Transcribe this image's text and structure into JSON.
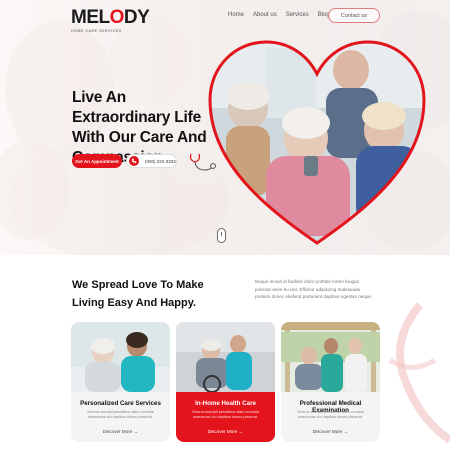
{
  "brand": {
    "name_before": "MEL",
    "name_o": "O",
    "name_after": "DY",
    "tagline": "HOME CARE SERVICES"
  },
  "nav": {
    "items": [
      "Home",
      "About us",
      "Services",
      "Blog"
    ],
    "contact_label": "Contact us"
  },
  "hero": {
    "title": "Live An Extraordinary Life With Our Care And Compassion.",
    "appointment_label": "Get An Appointment",
    "phone": "(000) 222-3333"
  },
  "intro": {
    "title": "We Spread Love To Make Living Easy And Happy.",
    "description": "Neque lectus id facilisis dolor porttitor lorem feugiat pulvinar enim eu nisl. Efficitur adipiscing malesuada pretium donec eleifend parturient dapibus egestas neque."
  },
  "cards": [
    {
      "title": "Personalized Care Services",
      "text": "Viverra suscipit penatibus diam conubia maecenas dui dapibus donec placerat.",
      "link": "Discover More"
    },
    {
      "title": "In-Home Health Care",
      "text": "Viverra suscipit penatibus diam conubia maecenas dui dapibus donec placerat.",
      "link": "Discover More"
    },
    {
      "title": "Professional Medical Examination",
      "text": "Viverra suscipit penatibus diam conubia maecenas dui dapibus donec placerat.",
      "link": "Discover More"
    }
  ],
  "colors": {
    "accent": "#e3141b",
    "dark_text": "#111111",
    "muted_text": "#777777"
  }
}
